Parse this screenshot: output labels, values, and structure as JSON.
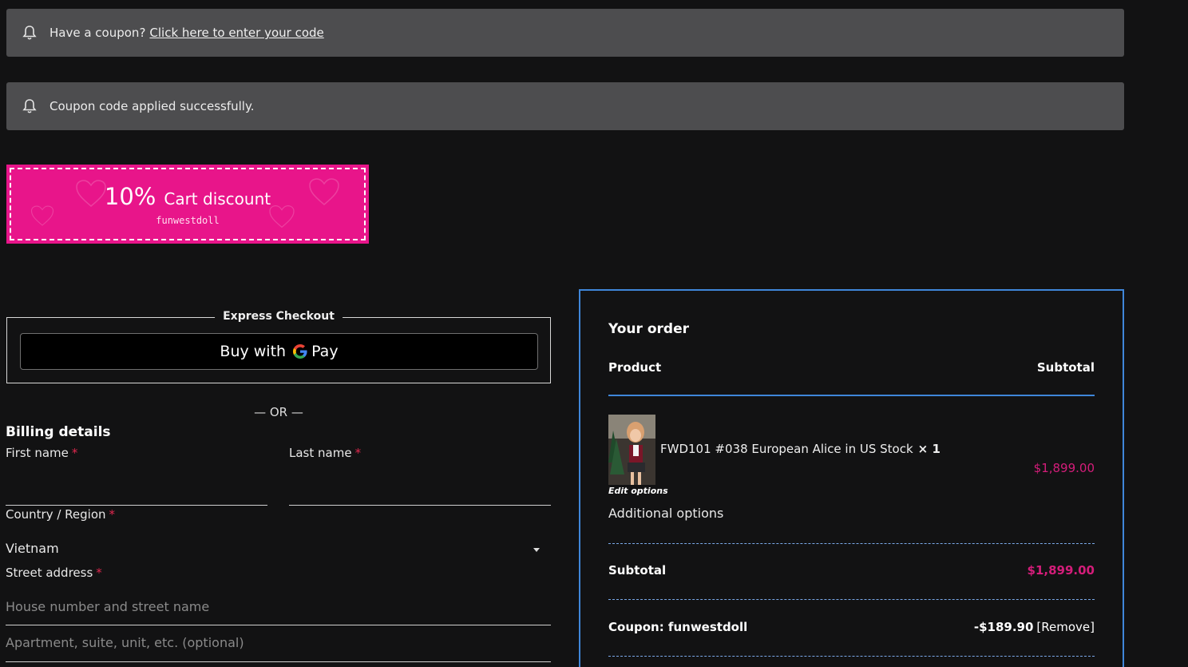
{
  "notices": {
    "coupon_prompt": {
      "text": "Have a coupon?",
      "link": "Click here to enter your code"
    },
    "coupon_applied": {
      "text": "Coupon code applied successfully."
    }
  },
  "promo": {
    "percent": "10%",
    "label": "Cart discount",
    "code": "funwestdoll",
    "color": "#e8158a"
  },
  "express_checkout": {
    "legend": "Express Checkout",
    "button_text": "Buy with",
    "button_brand": "Pay"
  },
  "or_separator": "— OR —",
  "billing": {
    "title": "Billing details",
    "first_name_label": "First name",
    "last_name_label": "Last name",
    "country_label": "Country / Region",
    "country_value": "Vietnam",
    "street_label": "Street address",
    "street_placeholder": "House number and street name",
    "street2_placeholder": "Apartment, suite, unit, etc. (optional)",
    "required_mark": "*"
  },
  "order": {
    "title": "Your order",
    "col_product": "Product",
    "col_subtotal": "Subtotal",
    "item": {
      "name": "FWD101 #038 European Alice in US Stock",
      "qty": "× 1",
      "price": "$1,899.00",
      "edit_options": "Edit options",
      "additional_options": "Additional options"
    },
    "subtotal_label": "Subtotal",
    "subtotal_value": "$1,899.00",
    "coupon_label": "Coupon: funwestdoll",
    "coupon_value": "-$189.90",
    "coupon_remove": "[Remove]",
    "accent_color": "#3f86d9",
    "price_color": "#d41d7a"
  }
}
